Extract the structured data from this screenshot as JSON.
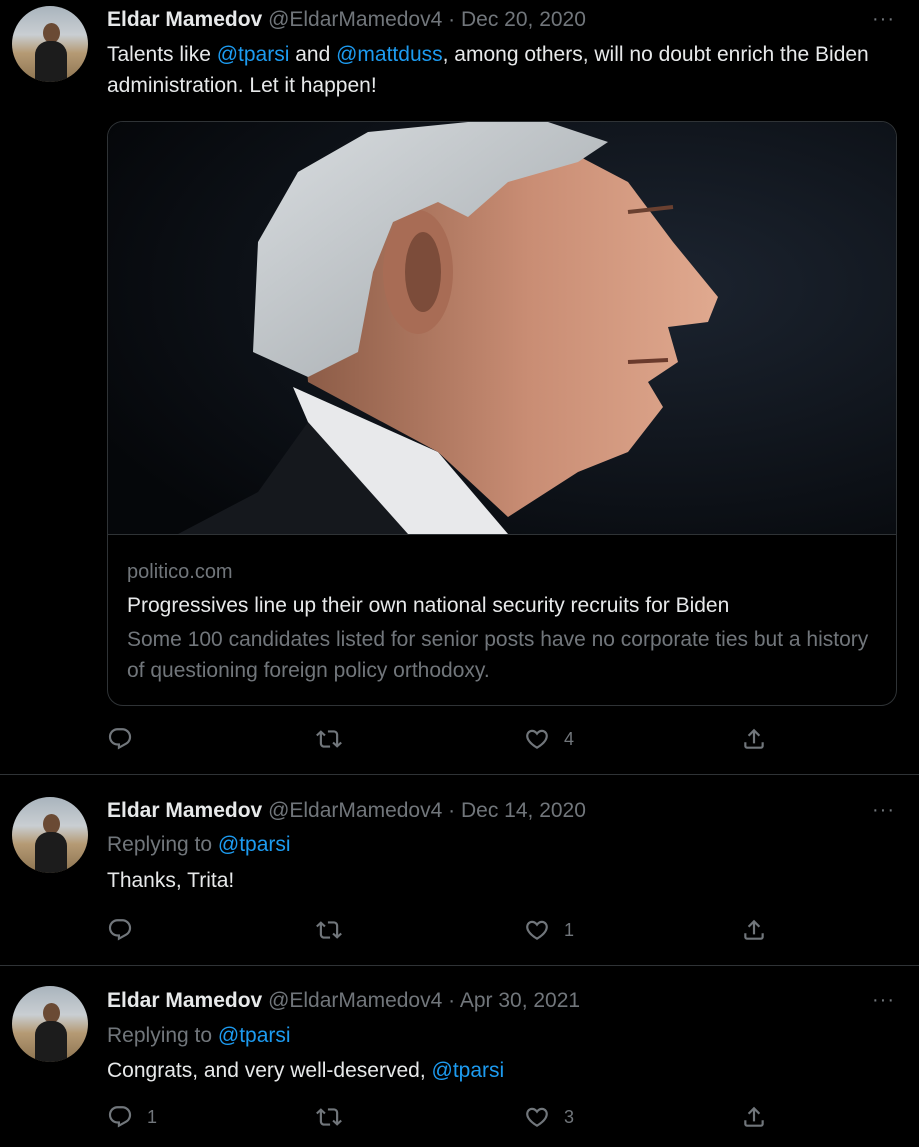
{
  "tweets": [
    {
      "name": "Eldar Mamedov",
      "handle": "@EldarMamedov4",
      "dot": "·",
      "date": "Dec 20, 2020",
      "more": "···",
      "text_1": "Talents like ",
      "mention_1": "@tparsi",
      "text_2": " and ",
      "mention_2": "@mattduss",
      "text_3": ", among others, will no doubt enrich the Biden administration. Let it happen!",
      "card": {
        "domain": "politico.com",
        "title": "Progressives line up their own national security recruits for Biden",
        "description": "Some 100 candidates listed for senior posts have no corporate ties but a history of questioning foreign policy orthodoxy."
      },
      "reply_count": "",
      "retweet_count": "",
      "like_count": "4"
    },
    {
      "name": "Eldar Mamedov",
      "handle": "@EldarMamedov4",
      "dot": "·",
      "date": "Dec 14, 2020",
      "more": "···",
      "replying_label": "Replying to ",
      "replying_to": "@tparsi",
      "text": "Thanks, Trita!",
      "reply_count": "",
      "retweet_count": "",
      "like_count": "1"
    },
    {
      "name": "Eldar Mamedov",
      "handle": "@EldarMamedov4",
      "dot": "·",
      "date": "Apr 30, 2021",
      "more": "···",
      "replying_label": "Replying to ",
      "replying_to": "@tparsi",
      "text": "Congrats, and very well-deserved, ",
      "mention": "@tparsi",
      "reply_count": "1",
      "retweet_count": "",
      "like_count": "3"
    }
  ],
  "icons": {
    "reply": "reply-icon",
    "retweet": "retweet-icon",
    "like": "heart-icon",
    "share": "share-icon",
    "more": "more-options-icon"
  },
  "colors": {
    "background": "#000000",
    "text": "#e7e9ea",
    "secondary": "#71767b",
    "link": "#1d9bf0",
    "border": "#2f3336"
  }
}
